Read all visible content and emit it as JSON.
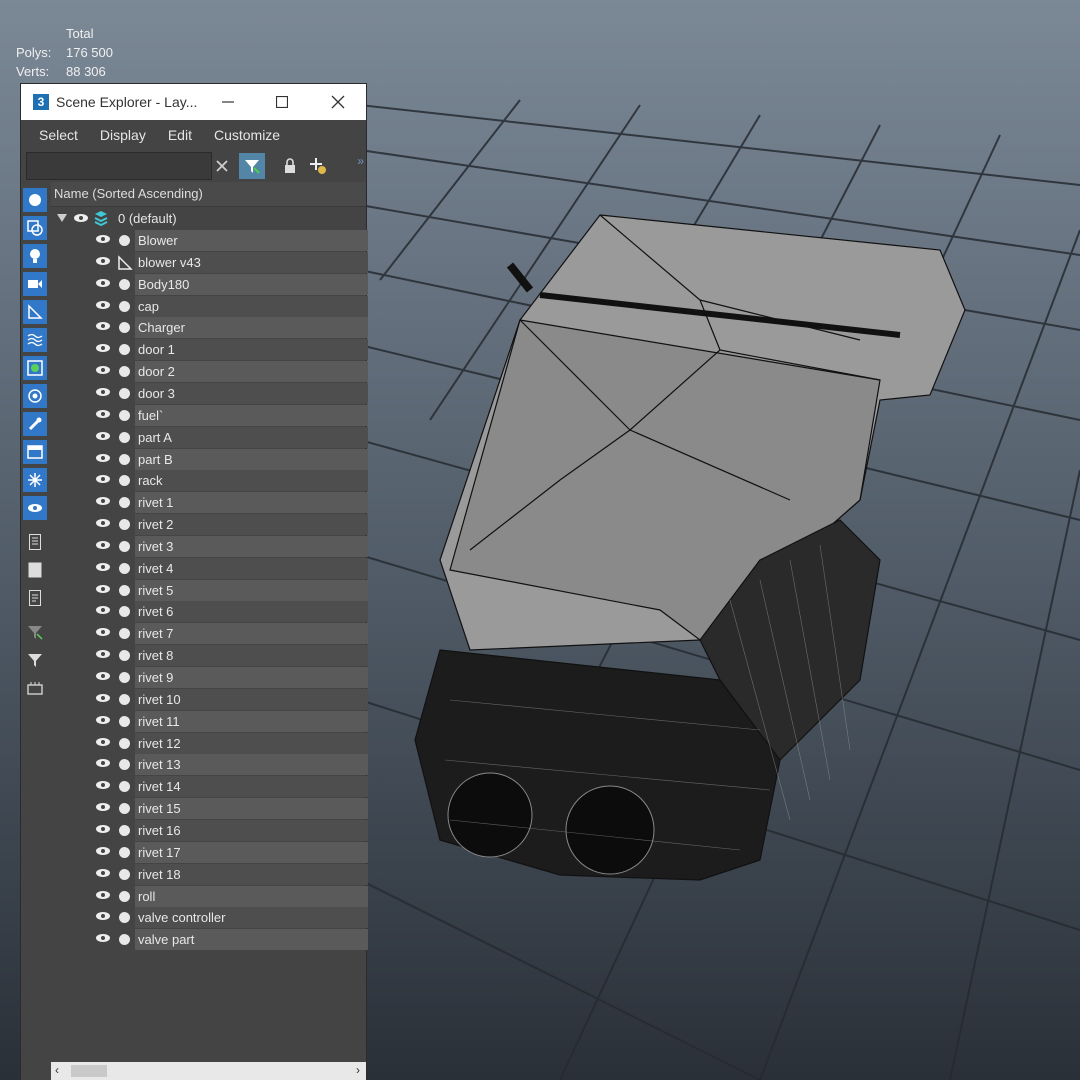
{
  "stats": {
    "header": "Total",
    "polys_label": "Polys:",
    "polys_value": "176 500",
    "verts_label": "Verts:",
    "verts_value": "88 306"
  },
  "window": {
    "app_badge": "3",
    "title": "Scene Explorer - Lay...",
    "controls": [
      "minimize-icon",
      "maximize-icon",
      "close-icon"
    ]
  },
  "menu": [
    "Select",
    "Display",
    "Edit",
    "Customize"
  ],
  "search": {
    "value": "",
    "placeholder": ""
  },
  "toolbar_icons": [
    "clear-icon",
    "filter-icon",
    "lock-icon",
    "add-layer-icon"
  ],
  "column_header": "Name (Sorted Ascending)",
  "root_layer": "0 (default)",
  "objects": [
    "Blower",
    "blower v43",
    "Body180",
    "cap",
    "Charger",
    "door 1",
    "door 2",
    "door 3",
    "fuel`",
    "part A",
    "part B",
    "rack",
    "rivet 1",
    "rivet 2",
    "rivet 3",
    "rivet 4",
    "rivet 5",
    "rivet 6",
    "rivet 7",
    "rivet 8",
    "rivet 9",
    "rivet 10",
    "rivet 11",
    "rivet 12",
    "rivet 13",
    "rivet 14",
    "rivet 15",
    "rivet 16",
    "rivet 17",
    "rivet 18",
    "roll",
    "valve controller",
    "valve part"
  ],
  "side_filters": [
    "geometry-icon",
    "shapes-icon",
    "lights-icon",
    "cameras-icon",
    "helpers-icon",
    "space-warps-icon",
    "groups-icon",
    "xrefs-icon",
    "bones-icon",
    "containers-icon",
    "frozen-icon",
    "hidden-icon",
    "display-all-icon",
    "display-none-icon",
    "invert-icon",
    "filter-off-icon",
    "filter-icon",
    "layers-icon"
  ],
  "colors": {
    "accent": "#3278c8",
    "panel_bg": "#444444",
    "viewport_bg": "#5f6c79"
  }
}
